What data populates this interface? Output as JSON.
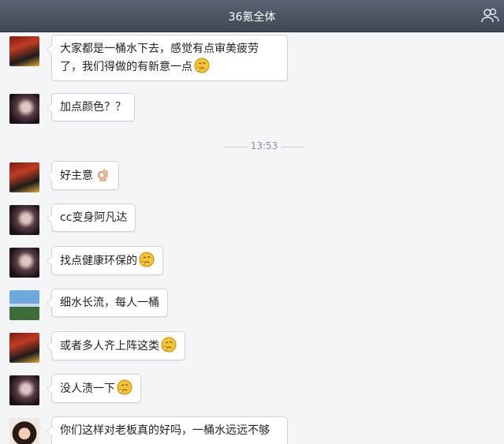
{
  "window": {
    "title": "36氪全体"
  },
  "timestamp": "13:53",
  "messages": [
    {
      "avatar": "red-character-avatar",
      "line1": "大家都是一桶水下去，感觉有点审美疲劳",
      "line2": "了，我们得做的有新意一点",
      "emoji": "thinking-emoji"
    },
    {
      "avatar": "dark-portrait-avatar",
      "text": "加点颜色？？"
    },
    {
      "avatar": "red-character-avatar",
      "text": "好主意",
      "emoji": "ok-hand-emoji"
    },
    {
      "avatar": "dark-portrait-avatar",
      "text": "cc变身阿凡达"
    },
    {
      "avatar": "dark-portrait-avatar",
      "text": "找点健康环保的",
      "emoji": "thinking-emoji"
    },
    {
      "avatar": "landscape-avatar",
      "text": "细水长流，每人一桶"
    },
    {
      "avatar": "red-character-avatar",
      "text": "或者多人齐上阵这类",
      "emoji": "thinking-emoji"
    },
    {
      "avatar": "dark-portrait-avatar",
      "text": "没人渍一下",
      "emoji": "thinking-emoji"
    },
    {
      "avatar": "girl-portrait-avatar",
      "text": "你们这样对老板真的好吗，一桶水远远不够"
    }
  ],
  "colors": {
    "titlebar": "#4a5360",
    "bubble_border": "#cfd2d6",
    "background": "#f4f5f7"
  }
}
